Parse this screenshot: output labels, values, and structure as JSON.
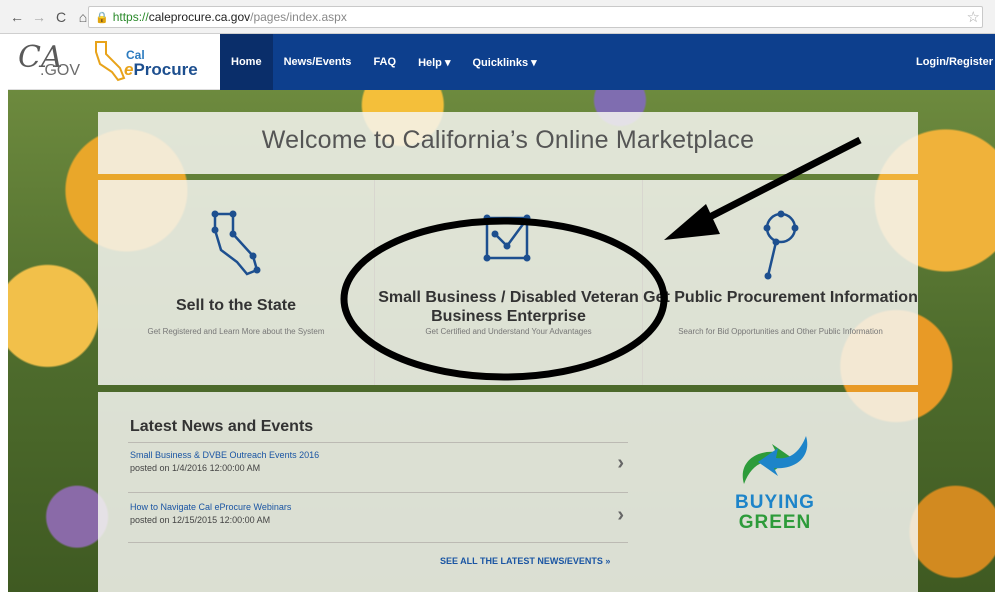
{
  "browser": {
    "url_secure": "https://",
    "url_host": "caleprocure.ca.gov",
    "url_path": "/pages/index.aspx"
  },
  "header": {
    "ca_logo": "CA",
    "gov_logo": ".GOV",
    "ep_cal": "Cal",
    "ep_e": "e",
    "ep_procure": "Procure",
    "nav": [
      "Home",
      "News/Events",
      "FAQ",
      "Help ▾",
      "Quicklinks ▾"
    ],
    "login": "Login/Register"
  },
  "hero": {
    "welcome": "Welcome to California’s Online Marketplace"
  },
  "cards": [
    {
      "title": "Sell to the State",
      "desc": "Get Registered and Learn More about the System"
    },
    {
      "title": "Small Business / Disabled Veteran Business Enterprise",
      "desc": "Get Certified and Understand Your Advantages"
    },
    {
      "title": "Get Public Procurement Information",
      "desc": "Search for Bid Opportunities and Other Public Information"
    }
  ],
  "news": {
    "heading": "Latest News and Events",
    "items": [
      {
        "title": "Small Business & DVBE Outreach Events 2016",
        "date": "posted on 1/4/2016 12:00:00 AM"
      },
      {
        "title": "How to Navigate Cal eProcure Webinars",
        "date": "posted on 12/15/2015 12:00:00 AM"
      }
    ],
    "see_all": "SEE ALL THE LATEST NEWS/EVENTS »"
  },
  "buying_green": {
    "word1": "BUYING",
    "word2": "GREEN"
  },
  "colors": {
    "nav_blue": "#0d3f8d",
    "annotation": "#000000"
  }
}
